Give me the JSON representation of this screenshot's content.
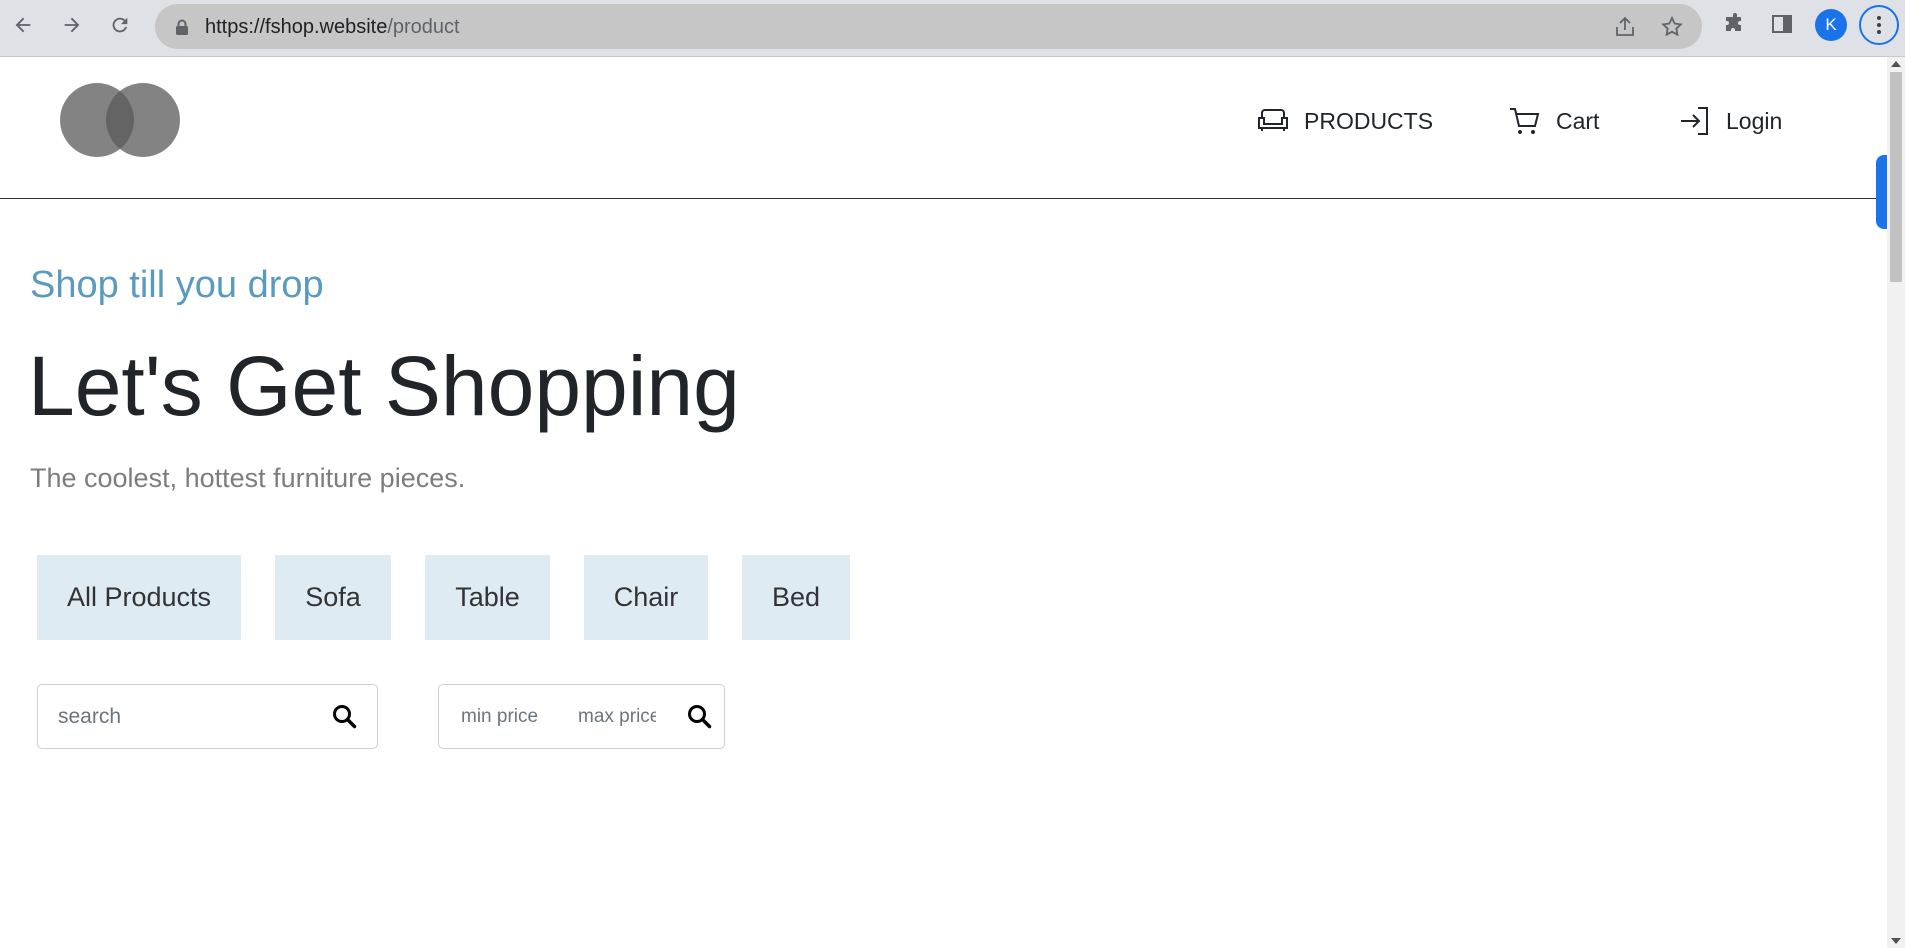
{
  "browser": {
    "url_host": "https://fshop.website",
    "url_path": "/product",
    "profile_initial": "K"
  },
  "nav": {
    "products_label": "PRODUCTS",
    "cart_label": "Cart",
    "login_label": "Login"
  },
  "hero": {
    "tagline": "Shop till you drop",
    "title": "Let's Get Shopping",
    "subtitle": "The coolest, hottest furniture pieces."
  },
  "categories": [
    "All Products",
    "Sofa",
    "Table",
    "Chair",
    "Bed"
  ],
  "filters": {
    "search_placeholder": "search",
    "min_price_placeholder": "min price",
    "max_price_placeholder": "max price"
  },
  "colors": {
    "tagline": "#5b9abf",
    "category_bg": "#deebf3",
    "accent": "#1a73e8"
  }
}
